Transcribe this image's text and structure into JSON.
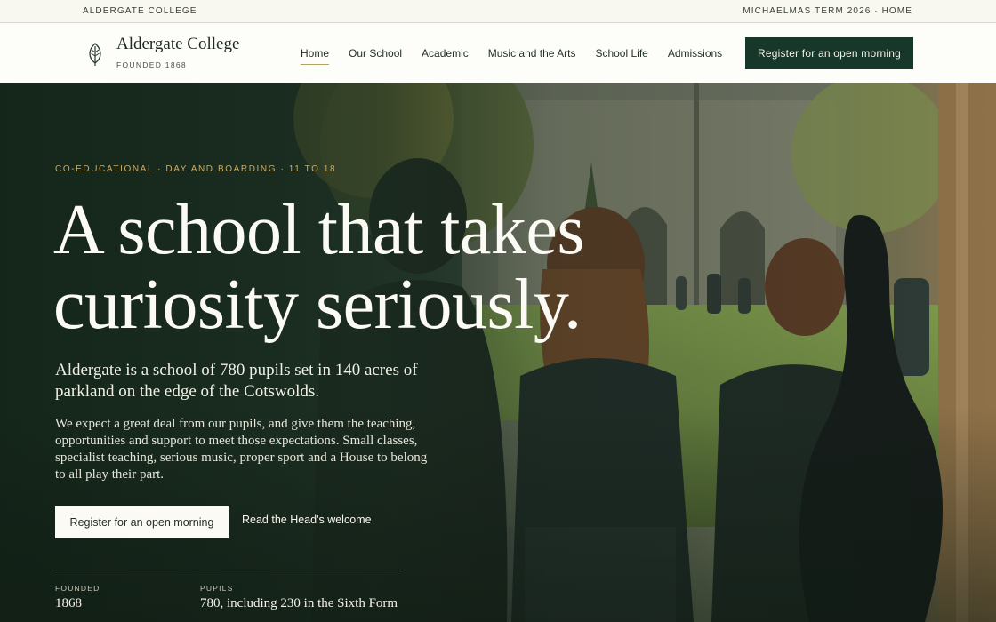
{
  "utility": {
    "left_text": "ALDERGATE COLLEGE",
    "term_text": "MICHAELMAS TERM 2026",
    "separator": " · ",
    "home_link": "HOME"
  },
  "header": {
    "brand_name": "Aldergate College",
    "brand_sub": "FOUNDED 1868",
    "crest_icon": "leaf-icon",
    "nav": [
      {
        "label": "Home",
        "active": true
      },
      {
        "label": "Our School",
        "active": false
      },
      {
        "label": "Academic",
        "active": false
      },
      {
        "label": "Music and the Arts",
        "active": false
      },
      {
        "label": "School Life",
        "active": false
      },
      {
        "label": "Admissions",
        "active": false
      }
    ],
    "cta_label": "Register for an open morning"
  },
  "hero": {
    "eyebrow": "CO-EDUCATIONAL · DAY AND BOARDING · 11 TO 18",
    "headline": "A school that takes curiosity seriously.",
    "lead": "Aldergate is a school of 780 pupils set in 140 acres of parkland on the edge of the Cotswolds.",
    "body": "We expect a great deal from our pupils, and give them the teaching, opportunities and support to meet those expectations. Small classes, specialist teaching, serious music, proper sport and a House to belong to all play their part.",
    "primary_button": "Register for an open morning",
    "secondary_link": "Read the Head's welcome",
    "stats": [
      {
        "label": "FOUNDED",
        "value": "1868"
      },
      {
        "label": "PUPILS",
        "value": "780, including 230 in the Sixth Form"
      }
    ]
  },
  "colors": {
    "brand_green": "#163729",
    "accent_gold": "#c7ad6b",
    "nav_underline": "#b5a268"
  }
}
